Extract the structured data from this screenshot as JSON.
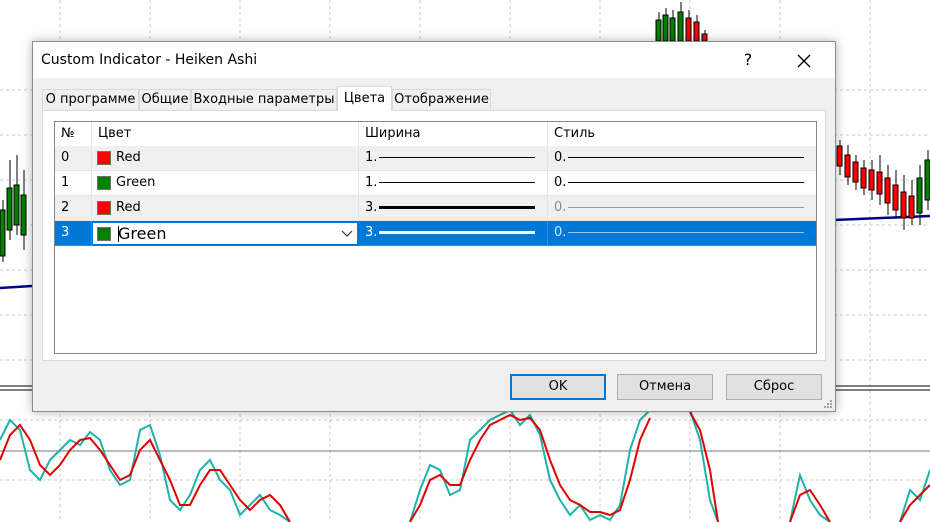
{
  "window": {
    "title": "Custom Indicator - Heiken Ashi",
    "help_label": "?",
    "close_label": "✕"
  },
  "tabs": [
    {
      "label": "О программе"
    },
    {
      "label": "Общие"
    },
    {
      "label": "Входные параметры"
    },
    {
      "label": "Цвета",
      "active": true
    },
    {
      "label": "Отображение"
    }
  ],
  "table": {
    "headers": {
      "num": "№",
      "color": "Цвет",
      "width": "Ширина",
      "style": "Стиль"
    },
    "rows": [
      {
        "num": "0",
        "color_name": "Red",
        "color_hex": "#ff0000",
        "width": "1.",
        "style": "0."
      },
      {
        "num": "1",
        "color_name": "Green",
        "color_hex": "#008000",
        "width": "1.",
        "style": "0."
      },
      {
        "num": "2",
        "color_name": "Red",
        "color_hex": "#ff0000",
        "width": "3.",
        "style": "0."
      },
      {
        "num": "3",
        "color_name": "Green",
        "color_hex": "#008000",
        "width": "3.",
        "style": "0.",
        "selected": true
      }
    ]
  },
  "buttons": {
    "ok": "OK",
    "cancel": "Отмена",
    "reset": "Сброс"
  },
  "colors": {
    "selection": "#0078d7",
    "row_alt": "#f0f0f0",
    "chart_blue": "#00008b",
    "chart_red": "#e00000",
    "chart_teal": "#20b2aa",
    "candle_green": "#008000",
    "candle_red": "#ff0000"
  },
  "icons": {
    "dropdown": "chevron-down-icon",
    "resize": "resize-grip-icon"
  }
}
